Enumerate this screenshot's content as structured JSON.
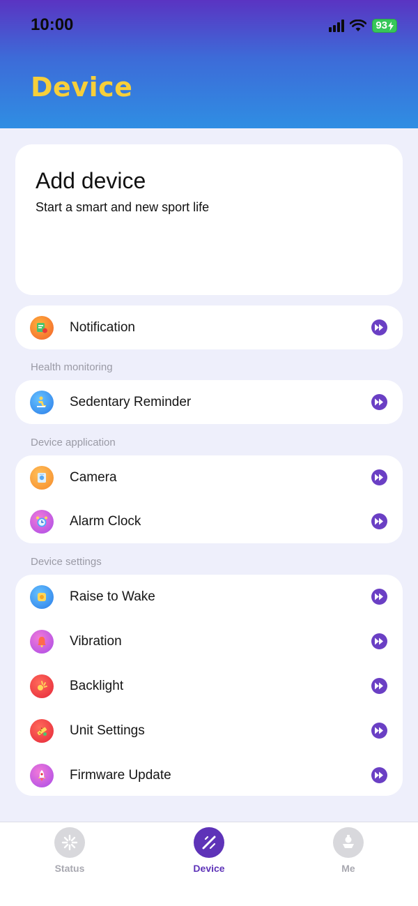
{
  "status_bar": {
    "time": "10:00",
    "battery": "93"
  },
  "header": {
    "title": "Device"
  },
  "add_device": {
    "title": "Add device",
    "subtitle": "Start a smart and new sport life"
  },
  "notification": {
    "label": "Notification",
    "icon": "notification-icon"
  },
  "health": {
    "section": "Health monitoring",
    "items": [
      {
        "label": "Sedentary Reminder",
        "icon": "sedentary-icon"
      }
    ]
  },
  "application": {
    "section": "Device application",
    "items": [
      {
        "label": "Camera",
        "icon": "camera-icon"
      },
      {
        "label": "Alarm Clock",
        "icon": "alarm-clock-icon"
      }
    ]
  },
  "settings": {
    "section": "Device settings",
    "items": [
      {
        "label": "Raise to Wake",
        "icon": "raise-to-wake-icon"
      },
      {
        "label": "Vibration",
        "icon": "vibration-icon"
      },
      {
        "label": "Backlight",
        "icon": "backlight-icon"
      },
      {
        "label": "Unit Settings",
        "icon": "unit-settings-icon"
      },
      {
        "label": "Firmware Update",
        "icon": "firmware-update-icon"
      }
    ]
  },
  "tabs": [
    {
      "label": "Status",
      "active": false
    },
    {
      "label": "Device",
      "active": true
    },
    {
      "label": "Me",
      "active": false
    }
  ],
  "colors": {
    "accent": "#5e33b8",
    "title": "#f7cf3a",
    "arrow": "#6a3fc4"
  }
}
